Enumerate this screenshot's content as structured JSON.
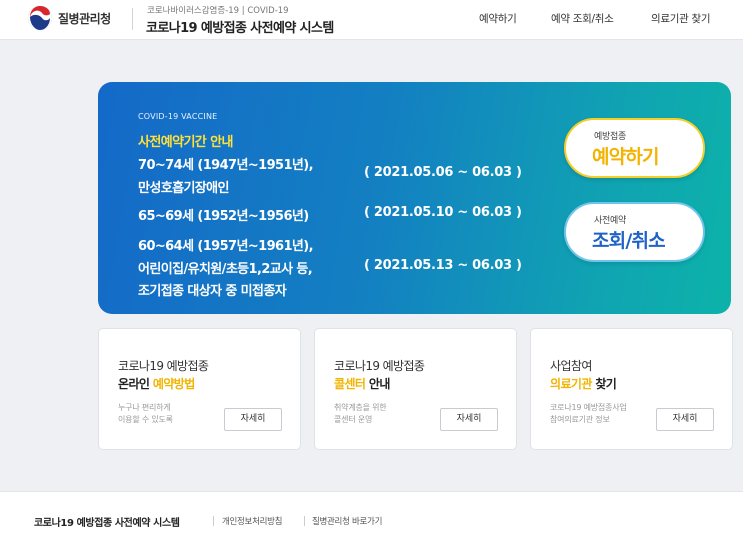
{
  "header": {
    "org_name": "질병관리청",
    "system_subtitle": "코로나바이러스감염증-19 | COVID-19",
    "system_title": "코로나19 예방접종 사전예약 시스템",
    "nav": [
      "예약하기",
      "예약 조회/취소",
      "의료기관 찾기"
    ]
  },
  "banner": {
    "eyebrow": "COVID-19 VACCINE",
    "heading": "사전예약기간 안내",
    "lines": [
      "70~74세 (1947년~1951년),",
      "만성호흡기장애인",
      "65~69세 (1952년~1956년)",
      "60~64세 (1957년~1961년),",
      "어린이집/유치원/초등1,2교사 등,",
      "조기접종 대상자 중 미접종자"
    ],
    "dates": [
      "( 2021.05.06 ~ 06.03 )",
      "( 2021.05.10 ~ 06.03 )",
      "( 2021.05.13 ~ 06.03 )"
    ],
    "reserve_button": {
      "small": "예방접종",
      "big": "예약하기"
    },
    "lookup_button": {
      "small": "사전예약",
      "big": "조회/취소"
    }
  },
  "cards": [
    {
      "line1": "코로나19 예방접종",
      "line2_plain": "온라인 ",
      "line2_highlight": "예약방법",
      "desc_lines": [
        "누구나 편리하게",
        "이용할 수 있도록"
      ],
      "button": "자세히"
    },
    {
      "line1": "코로나19 예방접종",
      "line2_highlight": "콜센터",
      "line2_plain": " 안내",
      "desc_lines": [
        "취약계층을 위한",
        "콜센터 운영"
      ],
      "button": "자세히"
    },
    {
      "line1": "사업참여",
      "line2_highlight": "의료기관",
      "line2_plain": " 찾기",
      "desc_lines": [
        "코로나19 예방접종사업",
        "참여의료기관 정보"
      ],
      "button": "자세히"
    }
  ],
  "footer": {
    "title": "코로나19 예방접종 사전예약 시스템",
    "links": [
      "개인정보처리방침",
      "질병관리청 바로가기"
    ]
  },
  "colors": {
    "accent_yellow": "#f2b400",
    "accent_blue": "#1f63c9",
    "banner_start": "#1469c8",
    "banner_end": "#0cb3a9"
  }
}
